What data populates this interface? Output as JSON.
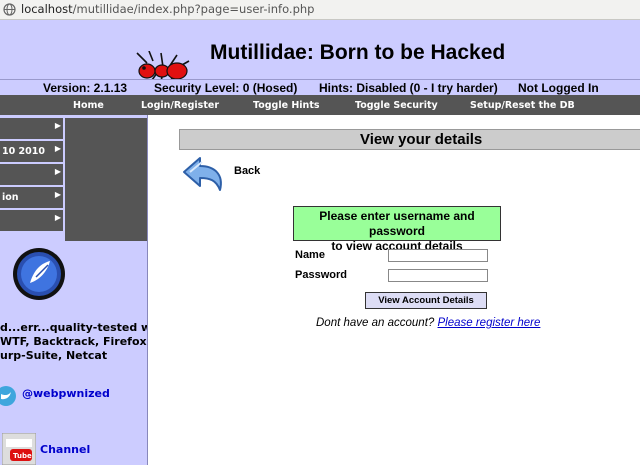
{
  "browser": {
    "url_host": "localhost",
    "url_path": "/mutillidae/index.php?page=user-info.php"
  },
  "header": {
    "title": "Mutillidae: Born to be Hacked",
    "version": "Version: 2.1.13",
    "security_level": "Security Level: 0 (Hosed)",
    "hints": "Hints: Disabled (0 - I try harder)",
    "login_status": "Not Logged In"
  },
  "menu": {
    "home": "Home",
    "login_register": "Login/Register",
    "toggle_hints": "Toggle Hints",
    "toggle_security": "Toggle Security",
    "setup_reset": "Setup/Reset the DB"
  },
  "sidebar": {
    "items": [
      {
        "label": ""
      },
      {
        "label": "10 2010"
      },
      {
        "label": ""
      },
      {
        "label": "ion"
      },
      {
        "label": ""
      }
    ],
    "promo_line1": "d...err...quality-tested with",
    "promo_line2": "WTF, Backtrack, Firefox,",
    "promo_line3": "urp-Suite, Netcat",
    "twitter_label": "@webpwnized",
    "youtube_label": "Channel"
  },
  "main": {
    "heading": "View your details",
    "back_label": "Back",
    "notice_line1": "Please enter username and password",
    "notice_line2": "to view account details",
    "name_label": "Name",
    "password_label": "Password",
    "submit_label": "View Account Details",
    "register_prompt": "Dont have an account?",
    "register_link": "Please register here"
  }
}
